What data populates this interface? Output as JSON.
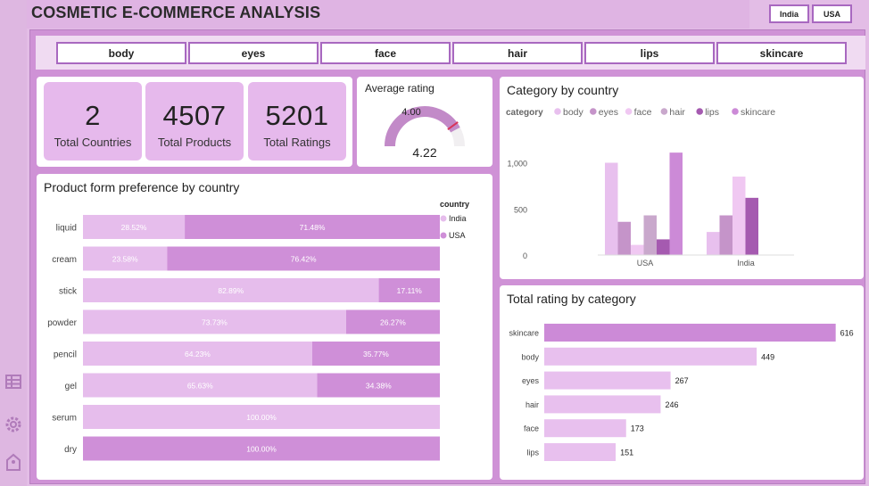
{
  "header": {
    "title": "COSMETIC E-COMMERCE ANALYSIS"
  },
  "country_buttons": [
    "India",
    "USA"
  ],
  "category_chips": [
    "body",
    "eyes",
    "face",
    "hair",
    "lips",
    "skincare"
  ],
  "kpis": [
    {
      "value": "2",
      "label": "Total Countries"
    },
    {
      "value": "4507",
      "label": "Total Products"
    },
    {
      "value": "5201",
      "label": "Total Ratings"
    }
  ],
  "gauge": {
    "title": "Average rating",
    "target_label": "4.00",
    "value_label": "4.22",
    "value": 4.22,
    "target": 4.0,
    "min": 0,
    "max": 5
  },
  "colors": {
    "india": "#e6bdec",
    "usa": "#cf8fd8",
    "body": "#e8c0ee",
    "eyes": "#c594c9",
    "face": "#f0c8f2",
    "hair": "#c9a8cc",
    "lips": "#a55ab0",
    "skincare": "#cc8ad7",
    "rating_top": "#cc8ad7",
    "rating_rest": "#e8c0ee"
  },
  "chart_data": [
    {
      "type": "bar",
      "orientation": "horizontal",
      "stacked": "100%",
      "title": "Product form preference by country",
      "legend_title": "country",
      "legend_position": "top-right",
      "categories": [
        "liquid",
        "cream",
        "stick",
        "powder",
        "pencil",
        "gel",
        "serum",
        "dry"
      ],
      "series": [
        {
          "name": "India",
          "values": [
            28.52,
            23.58,
            82.89,
            73.73,
            64.23,
            65.63,
            100.0,
            0
          ]
        },
        {
          "name": "USA",
          "values": [
            71.48,
            76.42,
            17.11,
            26.27,
            35.77,
            34.38,
            0,
            100.0
          ]
        }
      ],
      "labels": [
        [
          "28.52%",
          "71.48%"
        ],
        [
          "23.58%",
          "76.42%"
        ],
        [
          "82.89%",
          "17.11%"
        ],
        [
          "73.73%",
          "26.27%"
        ],
        [
          "64.23%",
          "35.77%"
        ],
        [
          "65.63%",
          "34.38%"
        ],
        [
          "100.00%",
          ""
        ],
        [
          "",
          "100.00%"
        ]
      ]
    },
    {
      "type": "bar",
      "title": "Category by country",
      "legend_title": "category",
      "legend_position": "top-left",
      "categories": [
        "USA",
        "India"
      ],
      "series": [
        {
          "name": "body",
          "values": [
            1000,
            250
          ]
        },
        {
          "name": "eyes",
          "values": [
            360,
            430
          ]
        },
        {
          "name": "face",
          "values": [
            110,
            850
          ]
        },
        {
          "name": "hair",
          "values": [
            430,
            0
          ]
        },
        {
          "name": "lips",
          "values": [
            170,
            620
          ]
        },
        {
          "name": "skincare",
          "values": [
            1110,
            0
          ]
        }
      ],
      "yticks": [
        "0",
        "500",
        "1,000"
      ],
      "ylim": [
        0,
        1150
      ]
    },
    {
      "type": "bar",
      "orientation": "horizontal",
      "title": "Total rating by category",
      "categories": [
        "skincare",
        "body",
        "eyes",
        "hair",
        "face",
        "lips"
      ],
      "values": [
        616,
        449,
        267,
        246,
        173,
        151
      ],
      "xlim": [
        0,
        660
      ]
    }
  ]
}
